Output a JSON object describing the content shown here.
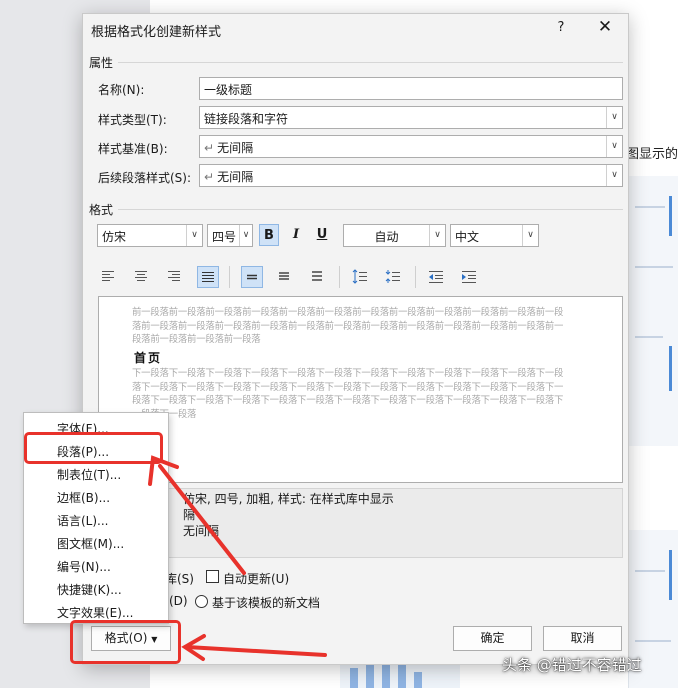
{
  "background": {
    "side_text": "图显示的"
  },
  "dialog": {
    "title": "根据格式化创建新样式",
    "help": "?",
    "close": "✕",
    "properties": {
      "section_label": "属性",
      "name_label": "名称(N):",
      "name_value": "一级标题",
      "style_type_label": "样式类型(T):",
      "style_type_value": "链接段落和字符",
      "style_based_label": "样式基准(B):",
      "style_based_value": "无间隔",
      "following_label": "后续段落样式(S):",
      "following_value": "无间隔"
    },
    "format": {
      "section_label": "格式",
      "font": "仿宋",
      "size": "四号",
      "bold": "B",
      "italic": "I",
      "underline": "U",
      "color": "自动",
      "language": "中文"
    },
    "preview": {
      "prev_text": "前一段落前一段落前一段落前一段落前一段落前一段落前一段落前一段落前一段落前一段落前一段落前一段落前一段落前一段落前一段落前一段落前一段落前一段落前一段落前一段落前一段落前一段落前一段落前一段落前一段落前一段落前一段落",
      "heading": "首页",
      "next_text": "下一段落下一段落下一段落下一段落下一段落下一段落下一段落下一段落下一段落下一段落下一段落下一段落下一段落下一段落下一段落下一段落下一段落下一段落下一段落下一段落下一段落下一段落下一段落下一段落下一段落下一段落下一段落下一段落下一段落下一段落下一段落下一段落下一段落下一段落下一段落下一段落下一段落"
    },
    "description": {
      "line1": "仿宋, 四号, 加粗, 样式: 在样式库中显示",
      "line2": "隔",
      "line3": "无间隔"
    },
    "options": {
      "add_to_gallery_partial": "库(S)",
      "auto_update": "自动更新(U)",
      "only_this_doc_partial": "(D)",
      "new_docs_template": "基于该模板的新文档"
    },
    "buttons": {
      "format": "格式(O)",
      "ok": "确定",
      "cancel": "取消"
    }
  },
  "menu": {
    "items": [
      "字体(F)...",
      "段落(P)...",
      "制表位(T)...",
      "边框(B)...",
      "语言(L)...",
      "图文框(M)...",
      "编号(N)...",
      "快捷键(K)...",
      "文字效果(E)..."
    ]
  },
  "watermark": "头条 @错过不容错过",
  "colors": {
    "annotation_red": "#e8322b",
    "toggle_active": "#cfe2f7"
  }
}
